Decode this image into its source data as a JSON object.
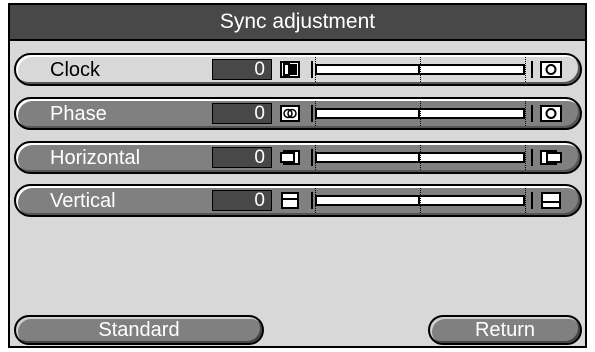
{
  "title": "Sync adjustment",
  "rows": [
    {
      "label": "Clock",
      "value": "0",
      "active": true,
      "slider_fraction": 0.5,
      "left_icon": "clock-narrow-icon",
      "right_icon": "clock-wide-icon"
    },
    {
      "label": "Phase",
      "value": "0",
      "active": false,
      "slider_fraction": 0.5,
      "left_icon": "phase-double-icon",
      "right_icon": "phase-single-icon"
    },
    {
      "label": "Horizontal",
      "value": "0",
      "active": false,
      "slider_fraction": 0.5,
      "left_icon": "shift-left-icon",
      "right_icon": "shift-right-icon"
    },
    {
      "label": "Vertical",
      "value": "0",
      "active": false,
      "slider_fraction": 0.5,
      "left_icon": "shift-down-icon",
      "right_icon": "shift-up-icon"
    }
  ],
  "buttons": {
    "standard": "Standard",
    "return": "Return"
  },
  "colors": {
    "panel_bg": "#d8d8d8",
    "titlebar_bg": "#484848",
    "inactive_row_bg": "#808080",
    "value_box_bg": "#484848"
  }
}
